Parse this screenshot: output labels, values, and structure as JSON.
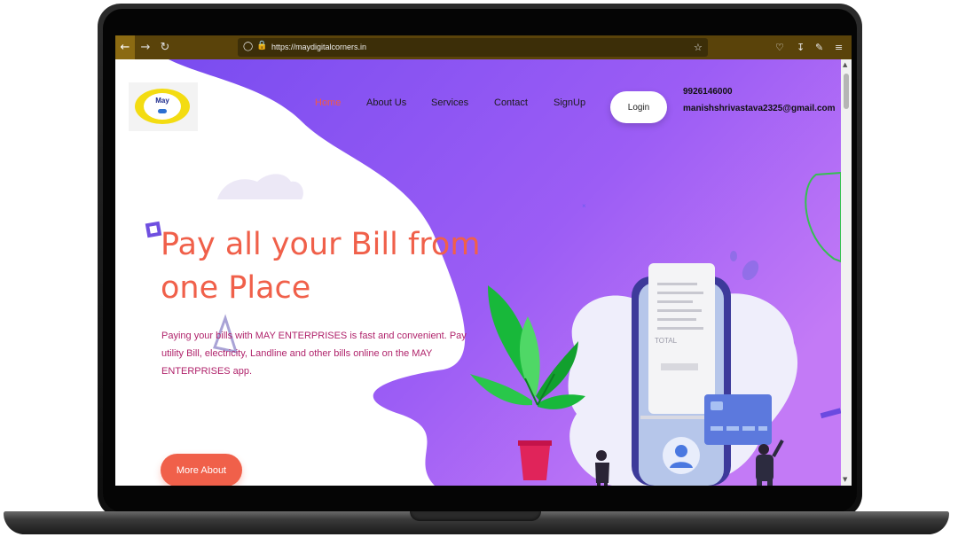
{
  "browser": {
    "url": "https://maydigitalcorners.in",
    "back_icon": "arrow-left-icon",
    "forward_icon": "arrow-right-icon",
    "reload_icon": "reload-icon"
  },
  "logo": {
    "text": "May"
  },
  "nav": {
    "items": [
      {
        "label": "Home",
        "active": true
      },
      {
        "label": "About Us"
      },
      {
        "label": "Services"
      },
      {
        "label": "Contact"
      },
      {
        "label": "SignUp"
      }
    ],
    "login_label": "Login"
  },
  "contact": {
    "phone": "9926146000",
    "email": "manishshrivastava2325@gmail.com"
  },
  "hero": {
    "title": "Pay all your Bill from one Place",
    "description": "Paying your bills with MAY ENTERPRISES is fast and convenient. Pay utility Bill, electricity, Landline and other bills online on the MAY ENTERPRISES app.",
    "button_label": "More About"
  },
  "illustration": {
    "receipt_label": "TOTAL"
  },
  "colors": {
    "accent": "#f0604a",
    "purple": "#9d5df5",
    "browser_bar": "#5a430a",
    "text_magenta": "#b0236b"
  }
}
